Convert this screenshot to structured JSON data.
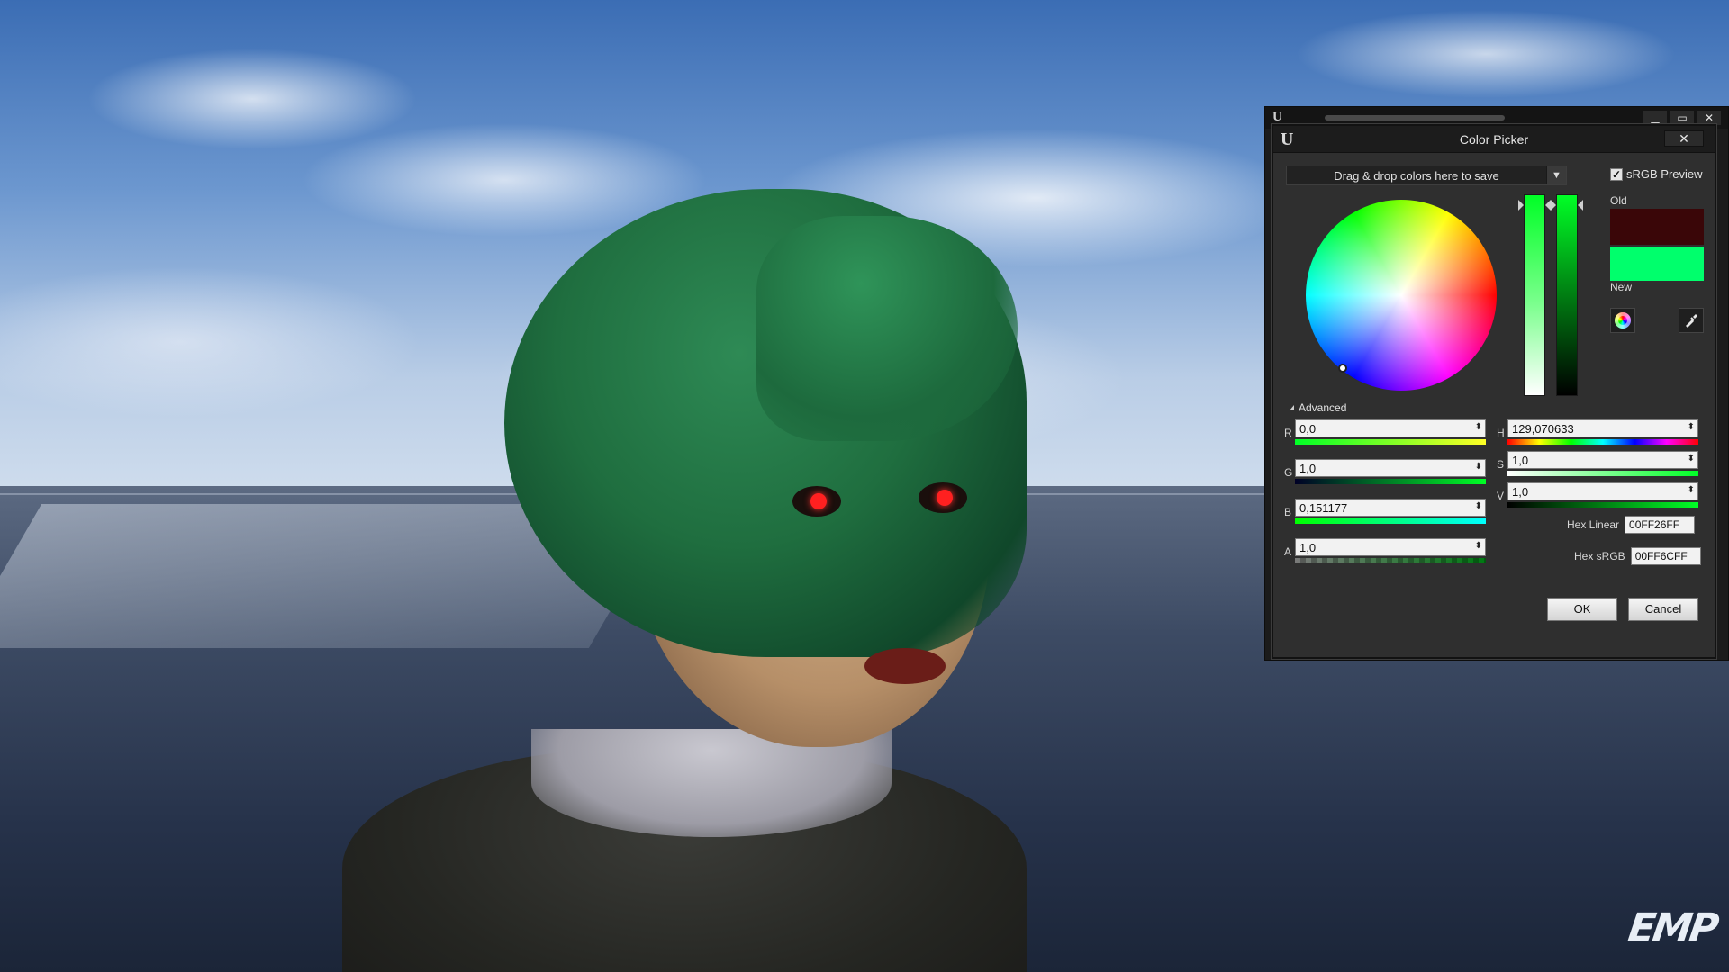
{
  "editor_window": {
    "controls": [
      "minimize-icon",
      "maximize-icon",
      "close-icon"
    ]
  },
  "color_picker": {
    "title": "Color Picker",
    "close_glyph": "✕",
    "swatch_bar_label": "Drag & drop colors here to save",
    "srgb_preview_label": "sRGB Preview",
    "srgb_preview_checked": true,
    "old_label": "Old",
    "new_label": "New",
    "old_color": "#3a0608",
    "new_color": "#00ff6c",
    "advanced_label": "Advanced",
    "rgba": {
      "r_label": "R",
      "r_value": "0,0",
      "g_label": "G",
      "g_value": "1,0",
      "b_label": "B",
      "b_value": "0,151177",
      "a_label": "A",
      "a_value": "1,0"
    },
    "hsv": {
      "h_label": "H",
      "h_value": "129,070633",
      "s_label": "S",
      "s_value": "1,0",
      "v_label": "V",
      "v_value": "1,0"
    },
    "hex_linear_label": "Hex Linear",
    "hex_linear_value": "00FF26FF",
    "hex_srgb_label": "Hex sRGB",
    "hex_srgb_value": "00FF6CFF",
    "ok_label": "OK",
    "cancel_label": "Cancel"
  },
  "watermark": "EMP"
}
